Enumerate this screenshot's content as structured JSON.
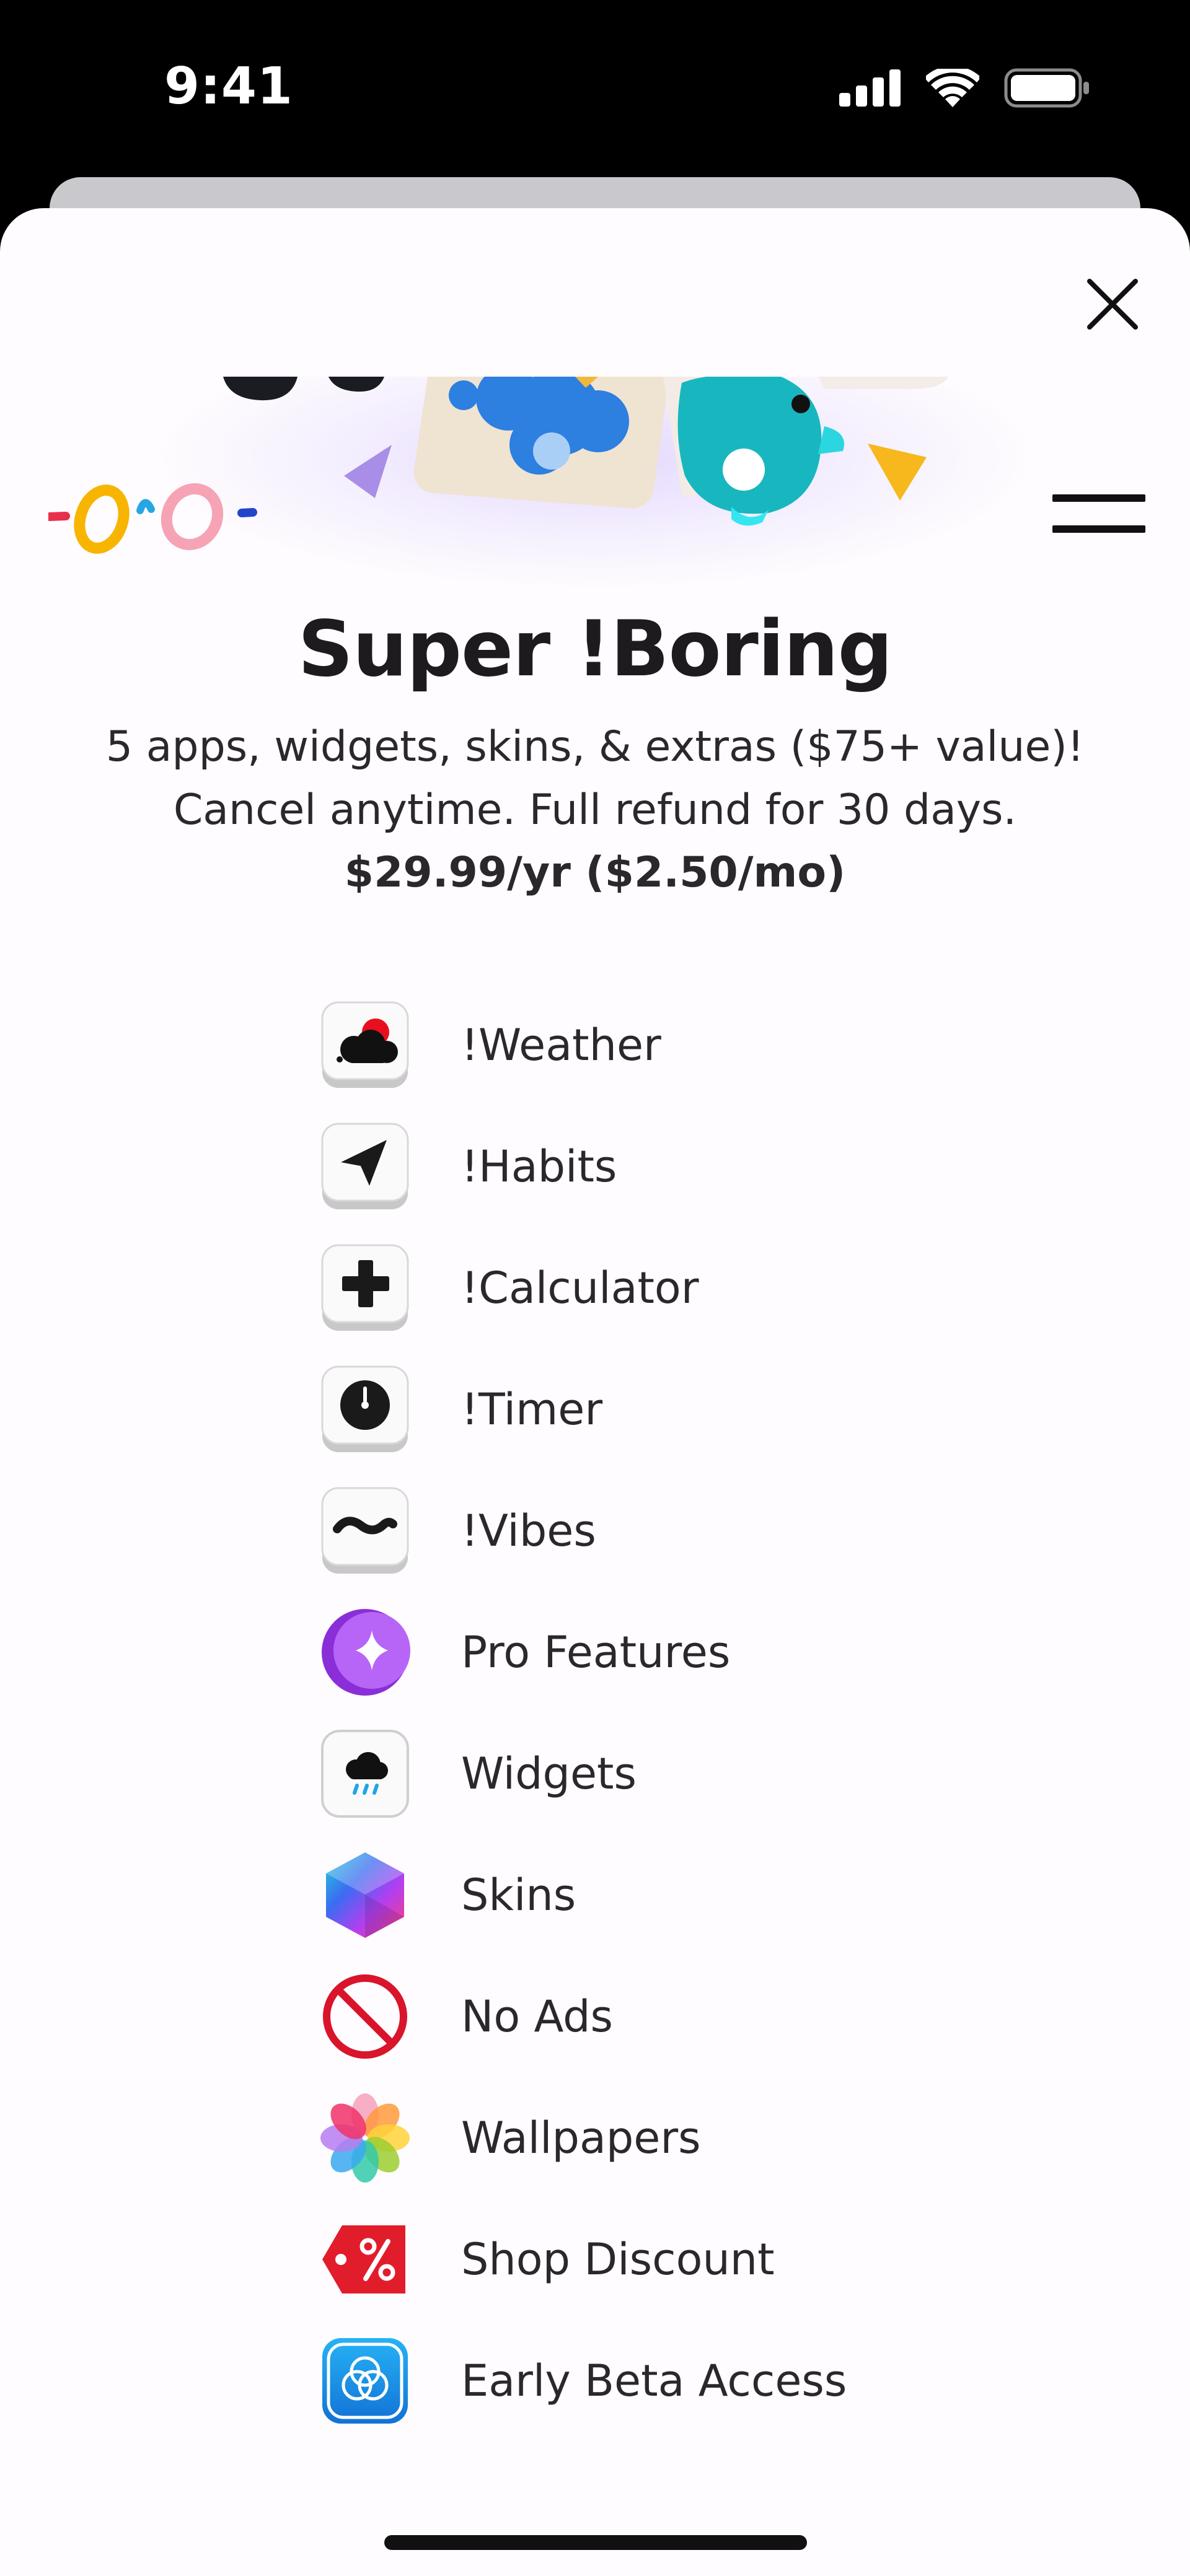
{
  "status_bar": {
    "time": "9:41"
  },
  "sheet": {
    "title": "Super !Boring",
    "description_line1": "5 apps, widgets, skins, & extras ($75+ value)!",
    "description_line2": "Cancel anytime. Full refund for 30 days.",
    "price": "$29.99/yr ($2.50/mo)"
  },
  "features": [
    {
      "label": "!Weather",
      "icon": "weather-app-icon"
    },
    {
      "label": "!Habits",
      "icon": "habits-app-icon"
    },
    {
      "label": "!Calculator",
      "icon": "calculator-app-icon"
    },
    {
      "label": "!Timer",
      "icon": "timer-app-icon"
    },
    {
      "label": "!Vibes",
      "icon": "vibes-app-icon"
    },
    {
      "label": "Pro Features",
      "icon": "sparkle-icon"
    },
    {
      "label": "Widgets",
      "icon": "widget-rain-cloud-icon"
    },
    {
      "label": "Skins",
      "icon": "hexagon-gradient-icon"
    },
    {
      "label": "No Ads",
      "icon": "no-sign-icon"
    },
    {
      "label": "Wallpapers",
      "icon": "flower-petals-icon"
    },
    {
      "label": "Shop Discount",
      "icon": "discount-tag-icon"
    },
    {
      "label": "Early Beta Access",
      "icon": "beta-circles-icon"
    }
  ],
  "colors": {
    "sheet_background": "#fefcfe",
    "text": "#2a282b",
    "logo_yellow": "#f7b500",
    "logo_pink": "#f5a3b5",
    "pro_purple": "#b45cf6",
    "no_ads_red": "#d9142b",
    "beta_blue": "#1a8fe8"
  }
}
